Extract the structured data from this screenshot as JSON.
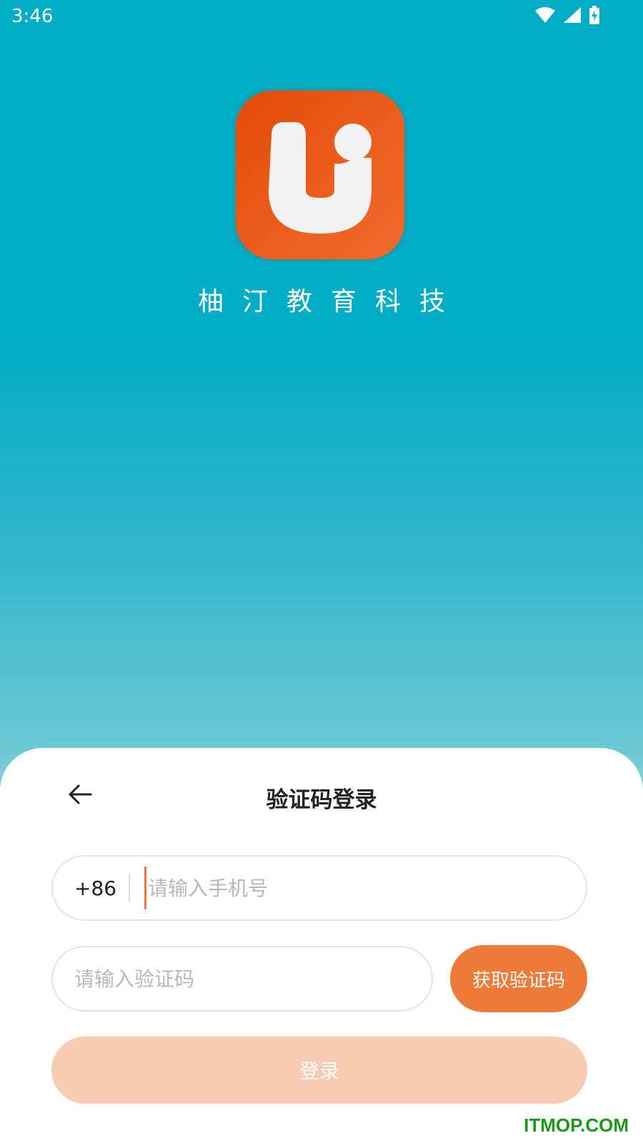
{
  "status_bar": {
    "time": "3:46",
    "icons": [
      "wifi-icon",
      "cellular-signal-icon",
      "battery-charging-icon"
    ]
  },
  "brand": {
    "logo_icon": "u-logo-icon",
    "name": "柚汀教育科技",
    "accent_color": "#ee7a38"
  },
  "login_sheet": {
    "back_icon": "arrow-left-icon",
    "title": "验证码登录",
    "phone": {
      "country_code": "+86",
      "value": "",
      "placeholder": "请输入手机号"
    },
    "code": {
      "value": "",
      "placeholder": "请输入验证码"
    },
    "get_code_label": "获取验证码",
    "login_label": "登录"
  },
  "watermark": "ITMOP.COM"
}
